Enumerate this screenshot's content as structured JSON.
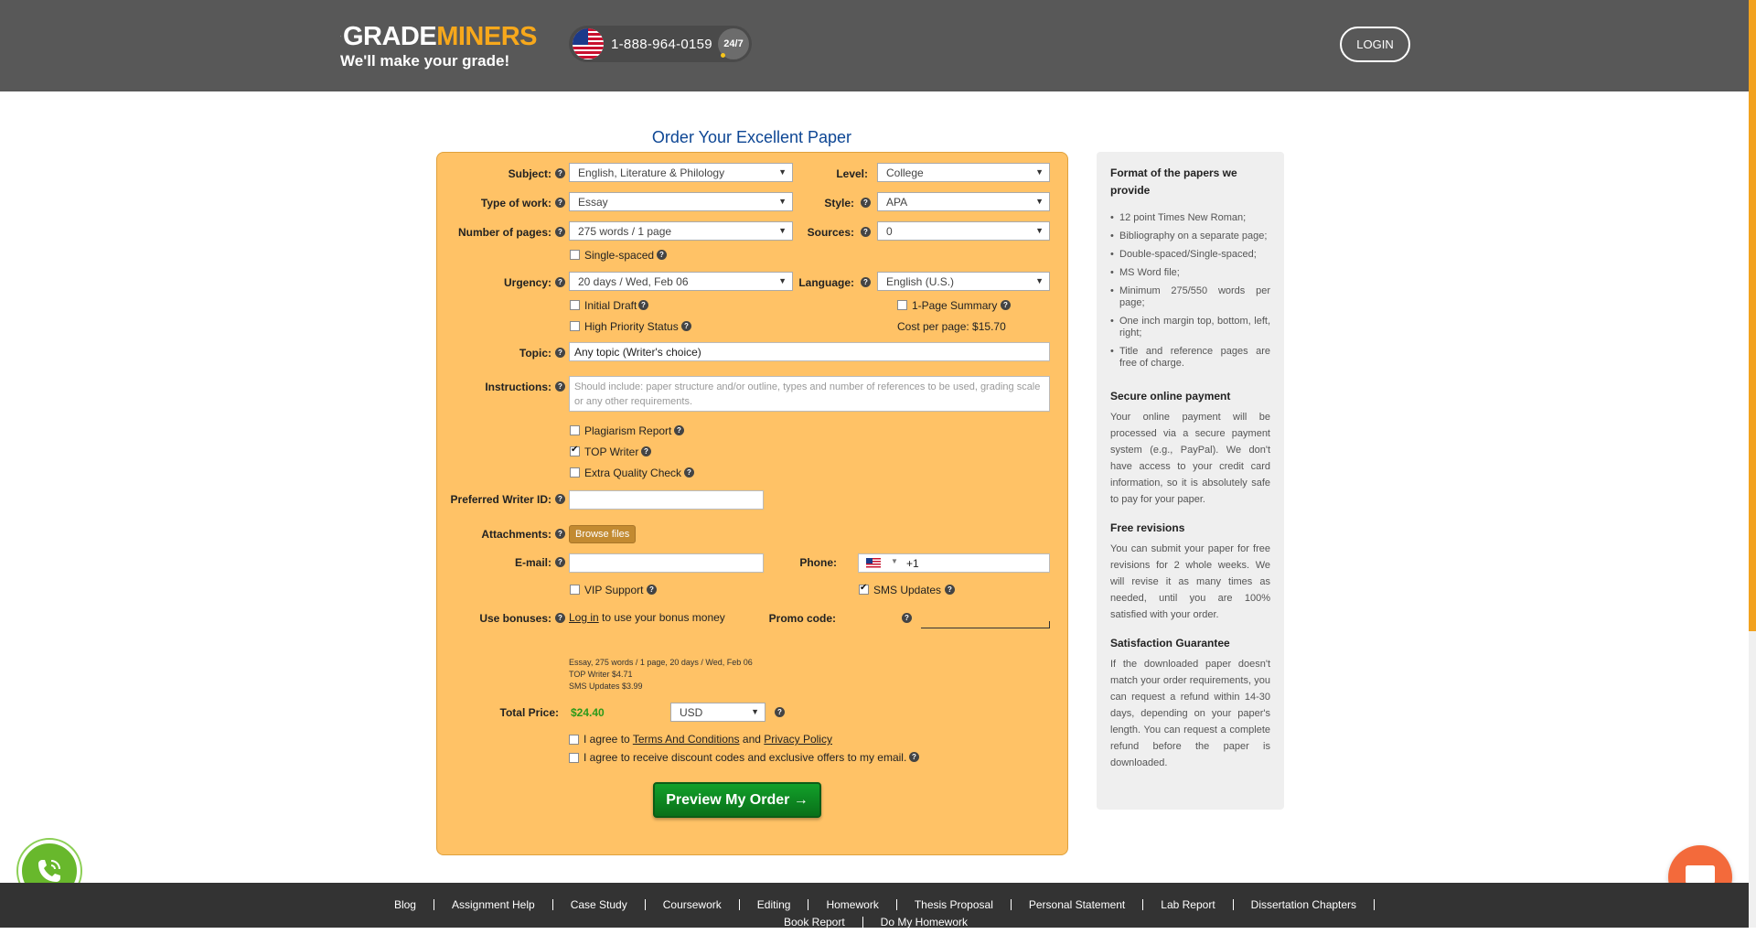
{
  "header": {
    "logo_word1": "GRADE",
    "logo_word2": "MINERS",
    "tagline": "We'll make your grade!",
    "phone": "1-888-964-0159",
    "badge": "24/7",
    "login": "LOGIN"
  },
  "form": {
    "title": "Order Your Excellent Paper",
    "subject": {
      "label": "Subject:",
      "value": "English, Literature & Philology"
    },
    "level": {
      "label": "Level:",
      "value": "College"
    },
    "type_of_work": {
      "label": "Type of work:",
      "value": "Essay"
    },
    "style": {
      "label": "Style:",
      "value": "APA"
    },
    "pages": {
      "label": "Number of pages:",
      "value": "275 words / 1 page"
    },
    "sources": {
      "label": "Sources:",
      "value": "0"
    },
    "single_spaced": "Single-spaced",
    "urgency": {
      "label": "Urgency:",
      "value": "20 days / Wed, Feb 06"
    },
    "language": {
      "label": "Language:",
      "value": "English (U.S.)"
    },
    "initial_draft": "Initial Draft",
    "one_page_summary": "1-Page Summary",
    "high_priority": "High Priority Status",
    "cost_per_page": "Cost per page: $15.70",
    "topic": {
      "label": "Topic:",
      "value": "Any topic (Writer's choice)"
    },
    "instructions": {
      "label": "Instructions:",
      "placeholder": "Should include: paper structure and/or outline, types and number of references to be used, grading scale or any other requirements."
    },
    "plagiarism_report": "Plagiarism Report",
    "top_writer": "TOP Writer",
    "extra_quality": "Extra Quality Check",
    "preferred_writer": {
      "label": "Preferred Writer ID:",
      "value": ""
    },
    "attachments": {
      "label": "Attachments:",
      "button": "Browse files"
    },
    "email": {
      "label": "E-mail:",
      "value": ""
    },
    "phone": {
      "label": "Phone:",
      "prefix": "+1"
    },
    "vip_support": "VIP Support",
    "sms_updates": "SMS Updates",
    "bonuses": {
      "label": "Use bonuses:",
      "link": "Log in",
      "text": "to use your bonus money"
    },
    "promo": {
      "label": "Promo code:"
    },
    "summary": [
      "Essay, 275 words / 1 page, 20 days / Wed, Feb 06",
      "TOP Writer $4.71",
      "SMS Updates $3.99"
    ],
    "total": {
      "label": "Total Price:",
      "value": "$24.40",
      "currency": "USD"
    },
    "agree": {
      "prefix": "I agree to",
      "terms": "Terms And Conditions",
      "and": "and",
      "privacy": "Privacy Policy"
    },
    "agree_discount": "I agree to receive discount codes and exclusive offers to my email.",
    "preview_button": "Preview My Order →",
    "checked": {
      "top_writer": true,
      "sms_updates": true
    }
  },
  "info": {
    "format_title": "Format of the papers we provide",
    "format_items": [
      "12 point Times New Roman;",
      "Bibliography on a separate page;",
      "Double-spaced/Single-spaced;",
      "MS Word file;",
      "Minimum 275/550 words per page;",
      "One inch margin top, bottom, left, right;",
      "Title and reference pages are free of charge."
    ],
    "payment_title": "Secure online payment",
    "payment_text": "Your online payment will be processed via a secure payment system (e.g., PayPal). We don't have access to your credit card information, so it is absolutely safe to pay for your paper.",
    "revisions_title": "Free revisions",
    "revisions_text": "You can submit your paper for free revisions for 2 whole weeks. We will revise it as many times as needed, until you are 100% satisfied with your order.",
    "guarantee_title": "Satisfaction Guarantee",
    "guarantee_text": "If the downloaded paper doesn't match your order requirements, you can request a refund within 14-30 days, depending on your paper's length. You can request a complete refund before the paper is downloaded."
  },
  "footer": {
    "links": [
      "Blog",
      "Assignment Help",
      "Case Study",
      "Coursework",
      "Editing",
      "Homework",
      "Thesis Proposal",
      "Personal Statement",
      "Lab Report",
      "Dissertation Chapters",
      "Book Report",
      "Do My Homework"
    ]
  },
  "icons": {
    "help": "question-icon",
    "call": "phone-icon",
    "chat": "chat-bubble-icon"
  },
  "colors": {
    "header_bg": "#585858",
    "accent": "#f7a81b",
    "form_bg": "#ffc266",
    "cta": "#12a02a",
    "price": "#2b9a1a"
  }
}
